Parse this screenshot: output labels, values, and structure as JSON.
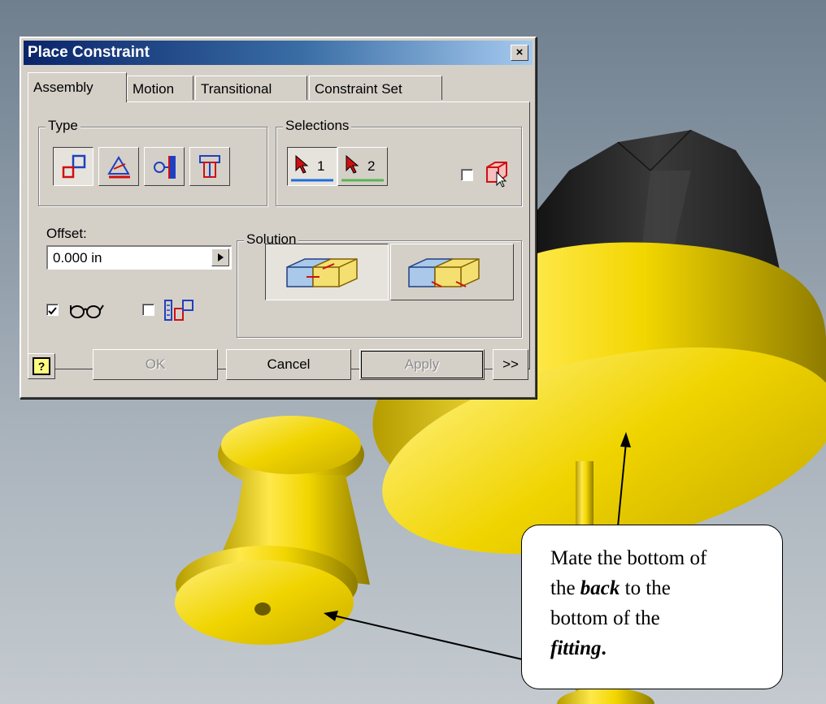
{
  "dialog": {
    "title": "Place Constraint",
    "close_symbol": "×",
    "tabs": [
      {
        "label": "Assembly",
        "active": true
      },
      {
        "label": "Motion",
        "active": false
      },
      {
        "label": "Transitional",
        "active": false
      },
      {
        "label": "Constraint Set",
        "active": false
      }
    ],
    "type_group": {
      "label": "Type",
      "buttons": [
        {
          "name": "mate-icon",
          "pressed": true
        },
        {
          "name": "angle-icon",
          "pressed": false
        },
        {
          "name": "tangent-icon",
          "pressed": false
        },
        {
          "name": "insert-icon",
          "pressed": false
        }
      ]
    },
    "selections_group": {
      "label": "Selections",
      "buttons": [
        {
          "label": "1",
          "pressed": true,
          "underline_color": "#1f6fd9"
        },
        {
          "label": "2",
          "pressed": false,
          "underline_color": "#5ab552"
        }
      ],
      "pick_part_first_checked": false
    },
    "offset": {
      "label": "Offset:",
      "value": "0.000 in"
    },
    "show_preview_checked": true,
    "predict_offset_checked": false,
    "solution_group": {
      "label": "Solution",
      "options": [
        {
          "name": "mate-solution-icon",
          "pressed": true
        },
        {
          "name": "flush-solution-icon",
          "pressed": false
        }
      ]
    },
    "buttons": {
      "help": "?",
      "ok": "OK",
      "cancel": "Cancel",
      "apply": "Apply",
      "more": ">>"
    }
  },
  "callout": {
    "line1": "Mate the bottom of",
    "the1": "the",
    "back": "back",
    "to_the": "to the",
    "line3": "bottom of the",
    "fitting": "fitting",
    "period": "."
  },
  "colors": {
    "part_yellow": "#e8d000",
    "knob_dark": "#2a2a2a",
    "title_bar": "#0a246a"
  }
}
